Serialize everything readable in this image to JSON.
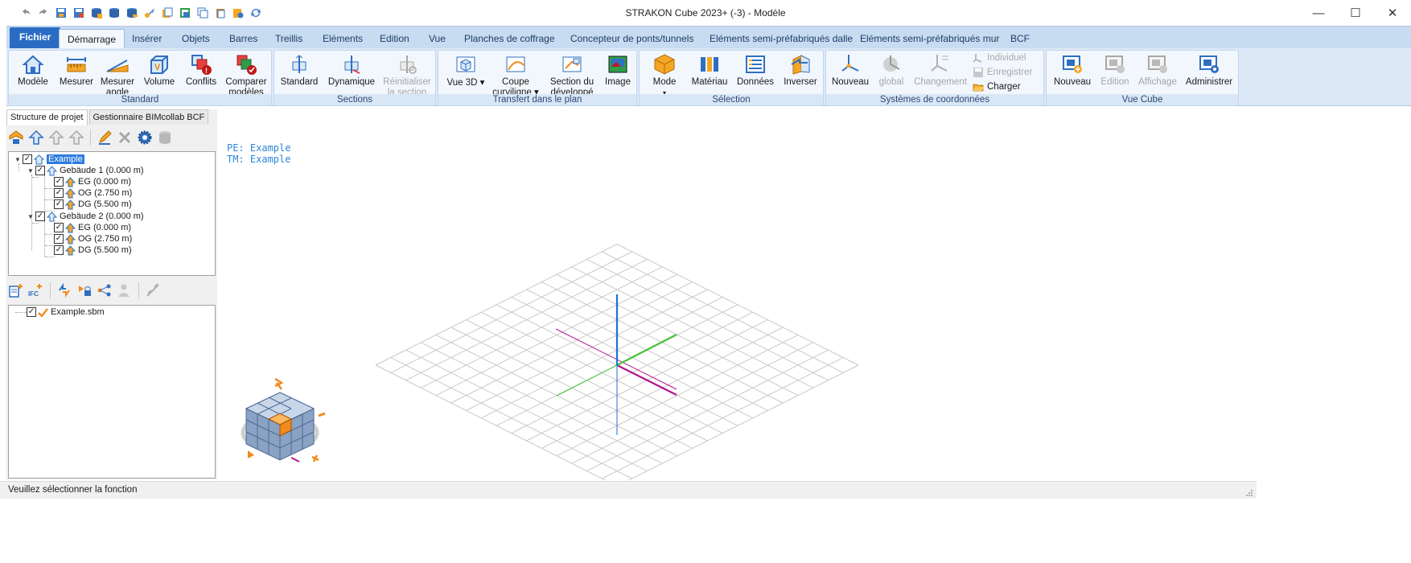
{
  "titlebar": {
    "title": "STRAKON Cube 2023+ (-3) - Modèle",
    "quick_access": [
      "undo-icon",
      "redo-icon",
      "save-project-icon",
      "save-as-icon",
      "database-icon",
      "database-plus-icon",
      "database-minus-icon",
      "key-icon",
      "copy-icon",
      "print-icon",
      "layers-icon",
      "paste-icon",
      "settings-icon",
      "refresh-icon"
    ],
    "controls": {
      "minimize": "—",
      "maximize": "☐",
      "close": "✕"
    }
  },
  "tabs": {
    "file": "Fichier",
    "items": [
      "Démarrage",
      "Insérer",
      "Objets",
      "Barres",
      "Treillis",
      "Eléments",
      "Edition",
      "Vue",
      "Planches de coffrage",
      "Concepteur de ponts/tunnels",
      "Eléments semi-préfabriqués dalle",
      "Eléments semi-préfabriqués mur",
      "BCF"
    ],
    "active": "Démarrage"
  },
  "ribbon": {
    "standard": {
      "label": "Standard",
      "buttons": [
        {
          "label": "Modèle",
          "icon": "house-icon"
        },
        {
          "label": "Mesurer",
          "icon": "measure-icon"
        },
        {
          "label": "Mesurer angle",
          "icon": "angle-icon"
        },
        {
          "label": "Volume",
          "icon": "volume-icon"
        },
        {
          "label": "Conflits",
          "icon": "conflicts-icon"
        },
        {
          "label": "Comparer modèles",
          "icon": "compare-icon"
        }
      ]
    },
    "sections": {
      "label": "Sections",
      "buttons": [
        {
          "label": "Standard",
          "icon": "section-standard-icon"
        },
        {
          "label": "Dynamique",
          "icon": "section-dynamic-icon"
        },
        {
          "label": "Réinitialiser la section",
          "icon": "section-reset-icon",
          "disabled": true
        }
      ]
    },
    "transfert": {
      "label": "Transfert dans le plan",
      "buttons": [
        {
          "label": "Vue 3D ▾",
          "icon": "view3d-icon"
        },
        {
          "label": "Coupe curviligne ▾",
          "icon": "curve-cut-icon"
        },
        {
          "label": "Section du développé",
          "icon": "developed-section-icon"
        },
        {
          "label": "Image",
          "icon": "image-icon"
        }
      ]
    },
    "selection": {
      "label": "Sélection",
      "buttons": [
        {
          "label": "Mode",
          "icon": "mode-icon"
        },
        {
          "label": "Matériau",
          "icon": "material-icon"
        },
        {
          "label": "Données",
          "icon": "data-icon"
        },
        {
          "label": "Inverser",
          "icon": "invert-icon"
        }
      ]
    },
    "coords": {
      "label": "Systèmes de coordonnées",
      "buttons": [
        {
          "label": "Nouveau",
          "icon": "axes-new-icon"
        },
        {
          "label": "global",
          "icon": "axes-global-icon",
          "disabled": true
        },
        {
          "label": "Changement",
          "icon": "axes-change-icon",
          "disabled": true
        }
      ],
      "small": [
        {
          "label": "Individuel",
          "icon": "individual-icon",
          "disabled": true
        },
        {
          "label": "Enregistrer",
          "icon": "save-icon",
          "disabled": true
        },
        {
          "label": "Charger",
          "icon": "folder-open-icon",
          "disabled": false
        }
      ]
    },
    "cube": {
      "label": "Vue Cube",
      "buttons": [
        {
          "label": "Nouveau",
          "icon": "cube-new-icon"
        },
        {
          "label": "Edition",
          "icon": "cube-edit-icon",
          "disabled": true
        },
        {
          "label": "Affichage",
          "icon": "cube-view-icon",
          "disabled": true
        },
        {
          "label": "Administrer",
          "icon": "cube-admin-icon"
        }
      ]
    }
  },
  "leftpanel": {
    "tabs": [
      "Structure de projet",
      "Gestionnaire BIMcollab BCF"
    ],
    "tree": {
      "root": "Example",
      "buildings": [
        {
          "label": "Gebäude 1 (0.000 m)",
          "levels": [
            "EG (0.000 m)",
            "OG (2.750 m)",
            "DG (5.500 m)"
          ]
        },
        {
          "label": "Gebäude 2 (0.000 m)",
          "levels": [
            "EG (0.000 m)",
            "OG (2.750 m)",
            "DG (5.500 m)"
          ]
        }
      ]
    },
    "files": [
      "Example.sbm"
    ]
  },
  "viewport": {
    "pe": "PE: Example",
    "tm": "TM: Example"
  },
  "status": {
    "text": "Veuillez sélectionner la fonction"
  },
  "colors": {
    "accent": "#2a6cc4",
    "info_text": "#2f86d6",
    "axis_blue": "#1f6fd1",
    "axis_green": "#46c23a",
    "axis_magenta": "#b0168f",
    "cube_orange": "#f08a1c"
  }
}
